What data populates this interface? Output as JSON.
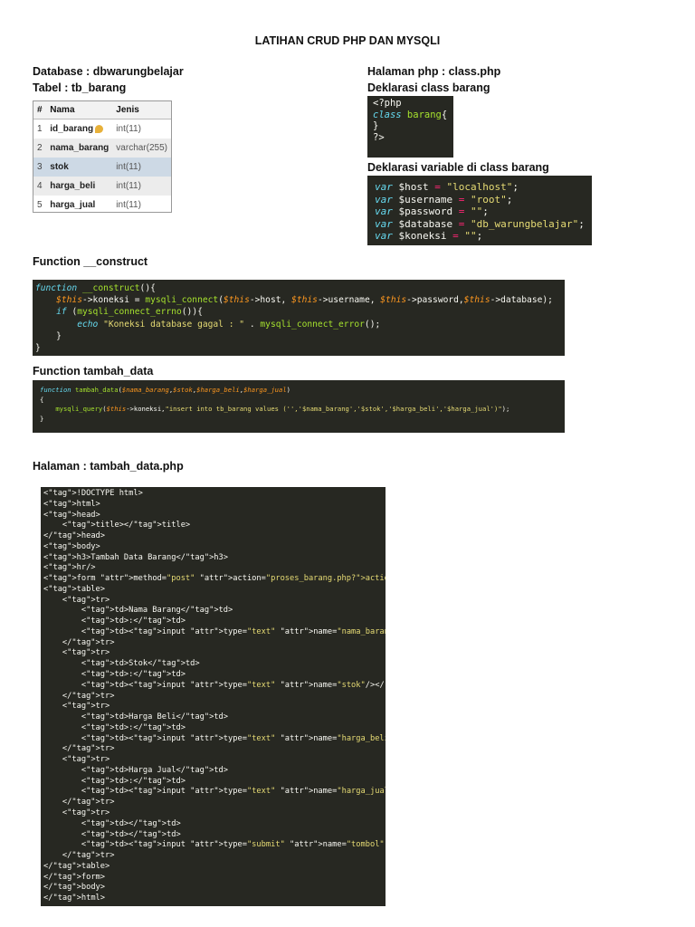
{
  "title": "LATIHAN CRUD PHP DAN MYSQLI",
  "left": {
    "database": "Database : dbwarungbelajar",
    "table": "Tabel : tb_barang"
  },
  "right": {
    "page": "Halaman php : class.php",
    "class_decl": "Deklarasi class barang",
    "var_decl": "Deklarasi variable di class barang"
  },
  "db_table": {
    "headers": [
      "#",
      "Nama",
      "Jenis"
    ],
    "rows": [
      {
        "num": "1",
        "name": "id_barang",
        "type": "int(11)"
      },
      {
        "num": "2",
        "name": "nama_barang",
        "type": "varchar(255)"
      },
      {
        "num": "3",
        "name": "stok",
        "type": "int(11)"
      },
      {
        "num": "4",
        "name": "harga_beli",
        "type": "int(11)"
      },
      {
        "num": "5",
        "name": "harga_jual",
        "type": "int(11)"
      }
    ]
  },
  "sections": {
    "construct": "Function __construct",
    "tambah": "Function tambah_data",
    "halaman": "Halaman : tambah_data.php"
  },
  "code_class": [
    "<?php",
    "class barang{",
    "",
    "}",
    "?>"
  ],
  "code_vars": [
    [
      "var",
      " $host",
      " = ",
      "\"localhost\"",
      ";"
    ],
    [
      "var",
      " $username",
      " = ",
      "\"root\"",
      ";"
    ],
    [
      "var",
      " $password",
      " = ",
      "\"\"",
      ";"
    ],
    [
      "var",
      " $database",
      " = ",
      "\"db_warungbelajar\"",
      ";"
    ],
    [
      "var",
      " $koneksi",
      " = ",
      "\"\"",
      ";"
    ]
  ],
  "code_construct": [
    "function __construct(){",
    "    $this->koneksi = mysqli_connect($this->host, $this->username, $this->password,$this->database);",
    "    if (mysqli_connect_errno()){",
    "        echo \"Koneksi database gagal : \" . mysqli_connect_error();",
    "    }",
    "}"
  ],
  "code_tambah": [
    "function tambah_data($nama_barang,$stok,$harga_beli,$harga_jual)",
    "{",
    "    mysqli_query($this->koneksi,\"insert into tb_barang values ('','$nama_barang','$stok','$harga_beli','$harga_jual')\");",
    "}"
  ],
  "code_html": [
    "<!DOCTYPE html>",
    "<html>",
    "<head>",
    "    <title></title>",
    "</head>",
    "<body>",
    "<h3>Tambah Data Barang</h3>",
    "<hr/>",
    "<form method=\"post\" action=\"proses_barang.php?action=add\">",
    "<table>",
    "    <tr>",
    "        <td>Nama Barang</td>",
    "        <td>:</td>",
    "        <td><input type=\"text\" name=\"nama_barang\"/></td>",
    "    </tr>",
    "    <tr>",
    "        <td>Stok</td>",
    "        <td>:</td>",
    "        <td><input type=\"text\" name=\"stok\"/></td>",
    "    </tr>",
    "    <tr>",
    "        <td>Harga Beli</td>",
    "        <td>:</td>",
    "        <td><input type=\"text\" name=\"harga_beli\"/></td>",
    "    </tr>",
    "    <tr>",
    "        <td>Harga Jual</td>",
    "        <td>:</td>",
    "        <td><input type=\"text\" name=\"harga_jual\"/></td>",
    "    </tr>",
    "    <tr>",
    "        <td></td>",
    "        <td></td>",
    "        <td><input type=\"submit\" name=\"tombol\" value=\"Simpan\"/></td>",
    "    </tr>",
    "</table>",
    "</form>",
    "</body>",
    "</html>"
  ]
}
